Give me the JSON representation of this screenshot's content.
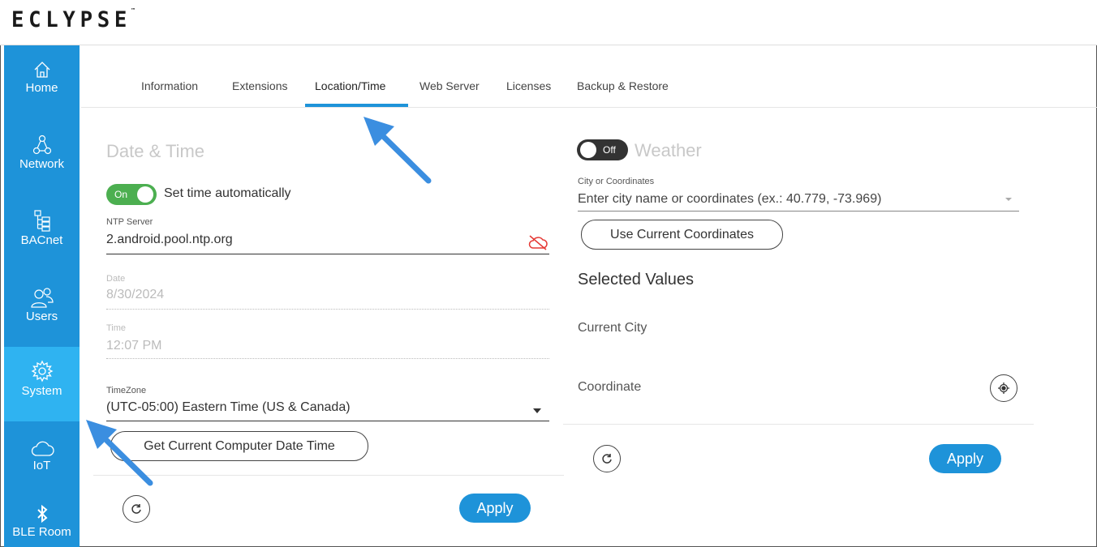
{
  "app": {
    "logo": "ECLYPSE",
    "trademark": "™"
  },
  "sidebar": {
    "items": [
      {
        "label": "Home",
        "icon": "home-icon"
      },
      {
        "label": "Network",
        "icon": "network-icon"
      },
      {
        "label": "BACnet",
        "icon": "bacnet-tree-icon"
      },
      {
        "label": "Users",
        "icon": "users-icon"
      },
      {
        "label": "System",
        "icon": "gear-icon",
        "active": true
      },
      {
        "label": "IoT",
        "icon": "cloud-icon"
      },
      {
        "label": "BLE Room",
        "icon": "bluetooth-icon"
      }
    ]
  },
  "tabs": [
    {
      "label": "Information"
    },
    {
      "label": "Extensions"
    },
    {
      "label": "Location/Time",
      "active": true
    },
    {
      "label": "Web Server"
    },
    {
      "label": "Licenses"
    },
    {
      "label": "Backup & Restore"
    }
  ],
  "datetime": {
    "title": "Date & Time",
    "auto_toggle": {
      "state": "On",
      "label": "Set time automatically",
      "on": true
    },
    "ntp": {
      "label": "NTP Server",
      "value": "2.android.pool.ntp.org",
      "status_icon": "cloud-off-icon"
    },
    "date": {
      "label": "Date",
      "value": "8/30/2024"
    },
    "time": {
      "label": "Time",
      "value": "12:07 PM"
    },
    "timezone": {
      "label": "TimeZone",
      "value": "(UTC-05:00) Eastern Time (US & Canada)"
    },
    "get_time_button": "Get Current Computer Date Time",
    "apply": "Apply"
  },
  "weather": {
    "toggle": {
      "state": "Off",
      "on": false
    },
    "title": "Weather",
    "city": {
      "label": "City or Coordinates",
      "placeholder": "Enter city name or coordinates (ex.: 40.779, -73.969)"
    },
    "use_coords_button": "Use Current Coordinates",
    "selected_heading": "Selected Values",
    "current_city_label": "Current City",
    "coordinate_label": "Coordinate",
    "apply": "Apply"
  },
  "colors": {
    "accent": "#1e93d9",
    "sidebar_active": "#2fb3f1",
    "toggle_on": "#4caf50",
    "toggle_off": "#333333",
    "error": "#e53935"
  }
}
